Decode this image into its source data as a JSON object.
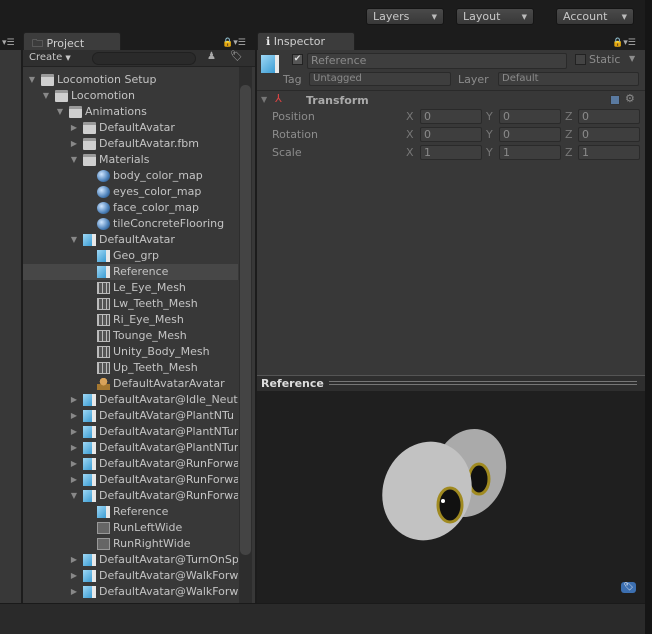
{
  "toolbar": {
    "layers": "Layers",
    "layout": "Layout",
    "account": "Account"
  },
  "project": {
    "tab": "Project",
    "create": "Create",
    "search_placeholder": "",
    "tree": [
      {
        "label": "Locomotion Setup",
        "level": 0,
        "icon": "folder",
        "state": "expanded"
      },
      {
        "label": "Locomotion",
        "level": 1,
        "icon": "folder",
        "state": "expanded"
      },
      {
        "label": "Animations",
        "level": 2,
        "icon": "folder",
        "state": "expanded"
      },
      {
        "label": "DefaultAvatar",
        "level": 3,
        "icon": "folder",
        "state": "collapsed"
      },
      {
        "label": "DefaultAvatar.fbm",
        "level": 3,
        "icon": "folder",
        "state": "collapsed"
      },
      {
        "label": "Materials",
        "level": 3,
        "icon": "folder",
        "state": "expanded"
      },
      {
        "label": "body_color_map",
        "level": 4,
        "icon": "material"
      },
      {
        "label": "eyes_color_map",
        "level": 4,
        "icon": "material"
      },
      {
        "label": "face_color_map",
        "level": 4,
        "icon": "material"
      },
      {
        "label": "tileConcreteFlooring",
        "level": 4,
        "icon": "material"
      },
      {
        "label": "DefaultAvatar",
        "level": 3,
        "icon": "prefab",
        "state": "expanded"
      },
      {
        "label": "Geo_grp",
        "level": 4,
        "icon": "prefab"
      },
      {
        "label": "Reference",
        "level": 4,
        "icon": "prefab",
        "selected": true
      },
      {
        "label": "Le_Eye_Mesh",
        "level": 4,
        "icon": "mesh"
      },
      {
        "label": "Lw_Teeth_Mesh",
        "level": 4,
        "icon": "mesh"
      },
      {
        "label": "Ri_Eye_Mesh",
        "level": 4,
        "icon": "mesh"
      },
      {
        "label": "Tounge_Mesh",
        "level": 4,
        "icon": "mesh"
      },
      {
        "label": "Unity_Body_Mesh",
        "level": 4,
        "icon": "mesh"
      },
      {
        "label": "Up_Teeth_Mesh",
        "level": 4,
        "icon": "mesh"
      },
      {
        "label": "DefaultAvatarAvatar",
        "level": 4,
        "icon": "avatar"
      },
      {
        "label": "DefaultAvatar@Idle_Neut",
        "level": 3,
        "icon": "prefab",
        "state": "collapsed"
      },
      {
        "label": "DefaultAVatar@PlantNTu",
        "level": 3,
        "icon": "prefab",
        "state": "collapsed"
      },
      {
        "label": "DefaultAvatar@PlantNTur",
        "level": 3,
        "icon": "prefab",
        "state": "collapsed"
      },
      {
        "label": "DefaultAvatar@PlantNTur",
        "level": 3,
        "icon": "prefab",
        "state": "collapsed"
      },
      {
        "label": "DefaultAvatar@RunForwa",
        "level": 3,
        "icon": "prefab",
        "state": "collapsed"
      },
      {
        "label": "DefaultAvatar@RunForwa",
        "level": 3,
        "icon": "prefab",
        "state": "collapsed"
      },
      {
        "label": "DefaultAvatar@RunForwa",
        "level": 3,
        "icon": "prefab",
        "state": "expanded"
      },
      {
        "label": "Reference",
        "level": 4,
        "icon": "prefab"
      },
      {
        "label": "RunLeftWide",
        "level": 4,
        "icon": "anim"
      },
      {
        "label": "RunRightWide",
        "level": 4,
        "icon": "anim"
      },
      {
        "label": "DefaultAvatar@TurnOnSp",
        "level": 3,
        "icon": "prefab",
        "state": "collapsed"
      },
      {
        "label": "DefaultAvatar@WalkForw",
        "level": 3,
        "icon": "prefab",
        "state": "collapsed"
      },
      {
        "label": "DefaultAvatar@WalkForw",
        "level": 3,
        "icon": "prefab",
        "state": "collapsed"
      }
    ]
  },
  "inspector": {
    "tab": "Inspector",
    "name": "Reference",
    "active": true,
    "static_label": "Static",
    "static": false,
    "tag_label": "Tag",
    "tag": "Untagged",
    "layer_label": "Layer",
    "layer": "Default",
    "transform": {
      "title": "Transform",
      "rows": [
        {
          "label": "Position",
          "x": "0",
          "y": "0",
          "z": "0"
        },
        {
          "label": "Rotation",
          "x": "0",
          "y": "0",
          "z": "0"
        },
        {
          "label": "Scale",
          "x": "1",
          "y": "1",
          "z": "1"
        }
      ]
    },
    "axes": {
      "x": "X",
      "y": "Y",
      "z": "Z"
    }
  },
  "preview": {
    "title": "Reference"
  }
}
